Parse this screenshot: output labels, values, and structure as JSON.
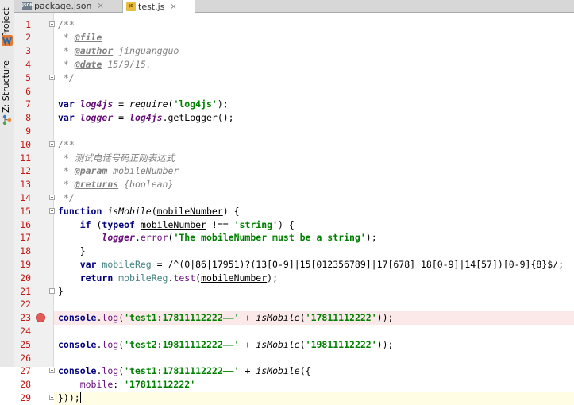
{
  "tool_strip": {
    "project_label": "Project",
    "structure_label": "Z: Structure",
    "icons": [
      "web-w-icon",
      "structure-tree-icon"
    ]
  },
  "tabs": [
    {
      "label": "package.json",
      "icon": "json-file-icon",
      "icon_text": "JSON",
      "active": false
    },
    {
      "label": "test.js",
      "icon": "js-file-icon",
      "icon_text": "JS",
      "active": true
    }
  ],
  "close_glyph": "×",
  "colors": {
    "keyword": "#000080",
    "string": "#008000",
    "comment": "#808080",
    "line_number": "#c41a16",
    "breakpoint": "#e35b59",
    "breakpoint_line": "#fbe9e9",
    "current_line": "#fffde3"
  },
  "breakpoint_line": 23,
  "current_line": 29,
  "fold_lines": [
    1,
    5,
    10,
    14,
    15,
    21,
    27,
    29
  ],
  "lines": [
    {
      "n": "1",
      "tokens": [
        {
          "t": "/**",
          "c": "cm"
        }
      ]
    },
    {
      "n": "2",
      "tokens": [
        {
          "t": " * ",
          "c": "cm"
        },
        {
          "t": "@file",
          "c": "tag"
        }
      ]
    },
    {
      "n": "3",
      "tokens": [
        {
          "t": " * ",
          "c": "cm"
        },
        {
          "t": "@author",
          "c": "tag"
        },
        {
          "t": " jinguangguo",
          "c": "cm"
        }
      ]
    },
    {
      "n": "4",
      "tokens": [
        {
          "t": " * ",
          "c": "cm"
        },
        {
          "t": "@date",
          "c": "tag"
        },
        {
          "t": " 15/9/15.",
          "c": "cm"
        }
      ]
    },
    {
      "n": "5",
      "tokens": [
        {
          "t": " */",
          "c": "cm"
        }
      ]
    },
    {
      "n": "6",
      "tokens": []
    },
    {
      "n": "7",
      "tokens": [
        {
          "t": "var ",
          "c": "kw"
        },
        {
          "t": "log4js",
          "c": "gv"
        },
        {
          "t": " = ",
          "c": "plain"
        },
        {
          "t": "require",
          "c": "fn"
        },
        {
          "t": "(",
          "c": "plain"
        },
        {
          "t": "'log4js'",
          "c": "str"
        },
        {
          "t": ");",
          "c": "plain"
        }
      ]
    },
    {
      "n": "8",
      "tokens": [
        {
          "t": "var ",
          "c": "kw"
        },
        {
          "t": "logger",
          "c": "gv"
        },
        {
          "t": " = ",
          "c": "plain"
        },
        {
          "t": "log4js",
          "c": "gv"
        },
        {
          "t": ".getLogger();",
          "c": "plain"
        }
      ]
    },
    {
      "n": "9",
      "tokens": []
    },
    {
      "n": "10",
      "tokens": [
        {
          "t": "/**",
          "c": "cm"
        }
      ]
    },
    {
      "n": "11",
      "tokens": [
        {
          "t": " * 测试电话号码正则表达式",
          "c": "cm"
        }
      ]
    },
    {
      "n": "12",
      "tokens": [
        {
          "t": " * ",
          "c": "cm"
        },
        {
          "t": "@param",
          "c": "tag"
        },
        {
          "t": " mobileNumber",
          "c": "cm"
        }
      ]
    },
    {
      "n": "13",
      "tokens": [
        {
          "t": " * ",
          "c": "cm"
        },
        {
          "t": "@returns",
          "c": "tag"
        },
        {
          "t": " {boolean}",
          "c": "cm"
        }
      ]
    },
    {
      "n": "14",
      "tokens": [
        {
          "t": " */",
          "c": "cm"
        }
      ]
    },
    {
      "n": "15",
      "tokens": [
        {
          "t": "function ",
          "c": "kw"
        },
        {
          "t": "isMobile",
          "c": "fn"
        },
        {
          "t": "(",
          "c": "plain"
        },
        {
          "t": "mobileNumber",
          "c": "ul"
        },
        {
          "t": ") {",
          "c": "plain"
        }
      ]
    },
    {
      "n": "16",
      "tokens": [
        {
          "t": "    ",
          "c": "plain"
        },
        {
          "t": "if ",
          "c": "kw"
        },
        {
          "t": "(",
          "c": "plain"
        },
        {
          "t": "typeof ",
          "c": "kw"
        },
        {
          "t": "mobileNumber",
          "c": "ul"
        },
        {
          "t": " !== ",
          "c": "plain"
        },
        {
          "t": "'string'",
          "c": "str"
        },
        {
          "t": ") {",
          "c": "plain"
        }
      ]
    },
    {
      "n": "17",
      "tokens": [
        {
          "t": "        ",
          "c": "plain"
        },
        {
          "t": "logger",
          "c": "gv"
        },
        {
          "t": ".",
          "c": "plain"
        },
        {
          "t": "error",
          "c": "prop"
        },
        {
          "t": "(",
          "c": "plain"
        },
        {
          "t": "'The mobileNumber must be a string'",
          "c": "str"
        },
        {
          "t": ");",
          "c": "plain"
        }
      ]
    },
    {
      "n": "18",
      "tokens": [
        {
          "t": "    }",
          "c": "plain"
        }
      ]
    },
    {
      "n": "19",
      "tokens": [
        {
          "t": "    ",
          "c": "plain"
        },
        {
          "t": "var ",
          "c": "kw"
        },
        {
          "t": "mobileReg",
          "c": "lv"
        },
        {
          "t": " = ",
          "c": "plain"
        },
        {
          "t": "/^(0|86|17951)?(13[0-9]|15[012356789]|17[678]|18[0-9]|14[57])[0-9]{8}$/",
          "c": "rx"
        },
        {
          "t": ";",
          "c": "plain"
        }
      ]
    },
    {
      "n": "20",
      "tokens": [
        {
          "t": "    ",
          "c": "plain"
        },
        {
          "t": "return ",
          "c": "kw"
        },
        {
          "t": "mobileReg",
          "c": "lv"
        },
        {
          "t": ".",
          "c": "plain"
        },
        {
          "t": "test",
          "c": "prop"
        },
        {
          "t": "(",
          "c": "plain"
        },
        {
          "t": "mobileNumber",
          "c": "ul"
        },
        {
          "t": ");",
          "c": "plain"
        }
      ]
    },
    {
      "n": "21",
      "tokens": [
        {
          "t": "}",
          "c": "plain"
        }
      ]
    },
    {
      "n": "22",
      "tokens": []
    },
    {
      "n": "23",
      "tokens": [
        {
          "t": "console",
          "c": "kw"
        },
        {
          "t": ".",
          "c": "plain"
        },
        {
          "t": "log",
          "c": "prop"
        },
        {
          "t": "(",
          "c": "plain"
        },
        {
          "t": "'test1:17811112222——'",
          "c": "str"
        },
        {
          "t": " + ",
          "c": "plain"
        },
        {
          "t": "isMobile",
          "c": "fn"
        },
        {
          "t": "(",
          "c": "plain"
        },
        {
          "t": "'17811112222'",
          "c": "str"
        },
        {
          "t": "));",
          "c": "plain"
        }
      ]
    },
    {
      "n": "24",
      "tokens": []
    },
    {
      "n": "25",
      "tokens": [
        {
          "t": "console",
          "c": "kw"
        },
        {
          "t": ".",
          "c": "plain"
        },
        {
          "t": "log",
          "c": "prop"
        },
        {
          "t": "(",
          "c": "plain"
        },
        {
          "t": "'test2:19811112222——'",
          "c": "str"
        },
        {
          "t": " + ",
          "c": "plain"
        },
        {
          "t": "isMobile",
          "c": "fn"
        },
        {
          "t": "(",
          "c": "plain"
        },
        {
          "t": "'19811112222'",
          "c": "str"
        },
        {
          "t": "));",
          "c": "plain"
        }
      ]
    },
    {
      "n": "26",
      "tokens": []
    },
    {
      "n": "27",
      "tokens": [
        {
          "t": "console",
          "c": "kw"
        },
        {
          "t": ".",
          "c": "plain"
        },
        {
          "t": "log",
          "c": "prop"
        },
        {
          "t": "(",
          "c": "plain"
        },
        {
          "t": "'test1:17811112222——'",
          "c": "str"
        },
        {
          "t": " + ",
          "c": "plain"
        },
        {
          "t": "isMobile",
          "c": "fn"
        },
        {
          "t": "({",
          "c": "plain"
        }
      ]
    },
    {
      "n": "28",
      "tokens": [
        {
          "t": "    ",
          "c": "plain"
        },
        {
          "t": "mobile",
          "c": "prop"
        },
        {
          "t": ": ",
          "c": "plain"
        },
        {
          "t": "'17811112222'",
          "c": "str"
        }
      ]
    },
    {
      "n": "29",
      "tokens": [
        {
          "t": "}));",
          "c": "plain"
        }
      ]
    }
  ]
}
